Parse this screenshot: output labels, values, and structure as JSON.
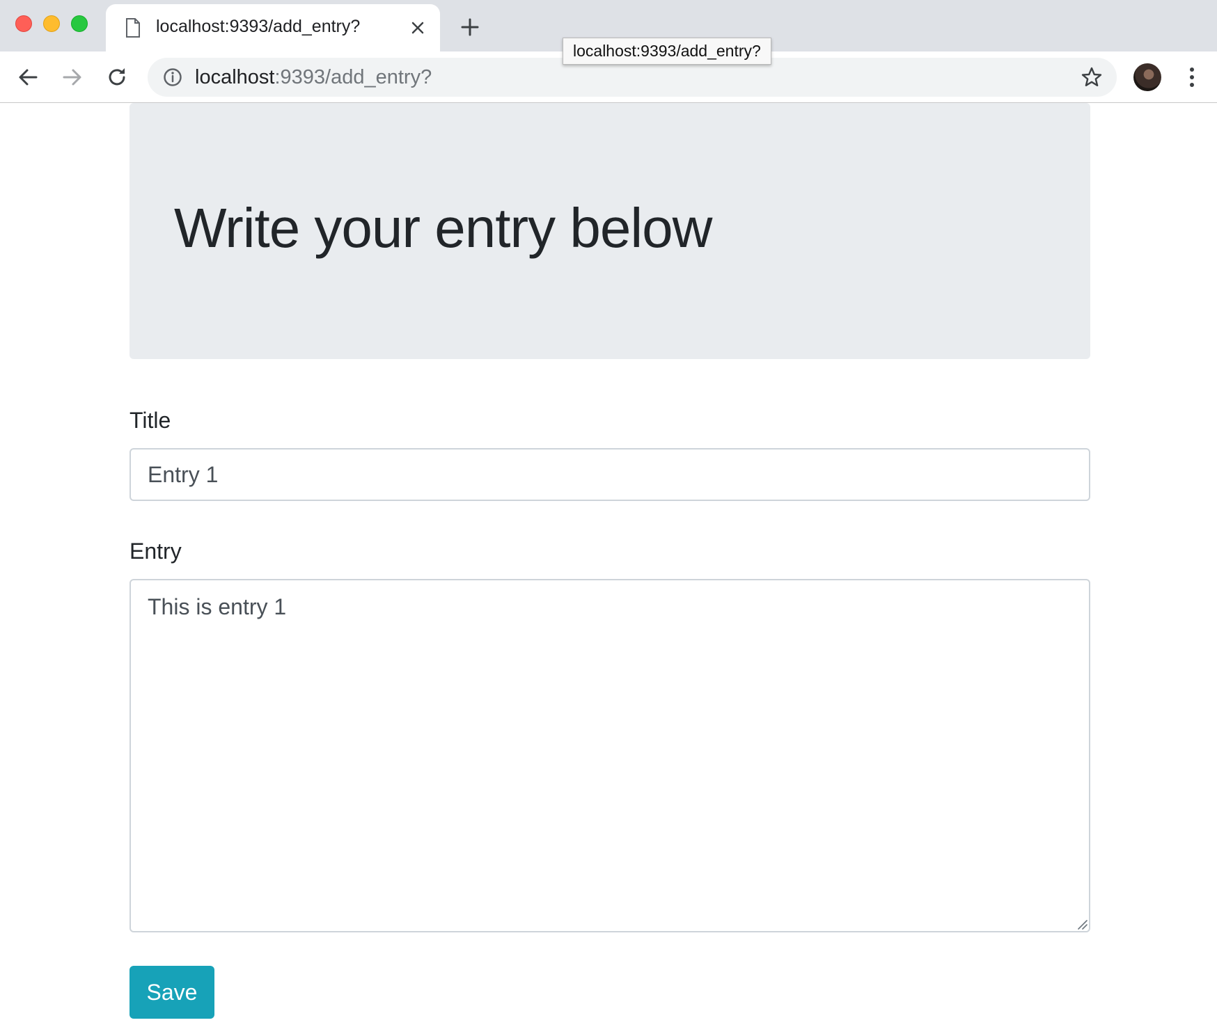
{
  "browser": {
    "tab_title": "localhost:9393/add_entry?",
    "url_host": "localhost",
    "url_rest": ":9393/add_entry?",
    "tooltip": "localhost:9393/add_entry?"
  },
  "icons": [
    "doc-icon",
    "close-icon",
    "plus-icon",
    "back-arrow-icon",
    "forward-arrow-icon",
    "reload-icon",
    "info-icon",
    "star-icon",
    "kebab-menu-icon"
  ],
  "page": {
    "heading": "Write your entry below",
    "title_label": "Title",
    "title_value": "Entry 1",
    "entry_label": "Entry",
    "entry_value": "This is entry 1",
    "save_label": "Save"
  },
  "colors": {
    "jumbotron_bg": "#e9ecef",
    "save_button": "#17a2b8",
    "tabstrip_bg": "#dee1e6"
  }
}
